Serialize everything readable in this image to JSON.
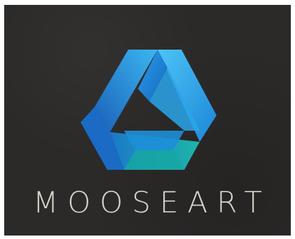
{
  "brand": {
    "name": "MOOSEART"
  },
  "logo": {
    "icon": "penrose-triangle-icon",
    "colors": {
      "light_blue": "#3bb7f0",
      "mid_blue": "#1d86d8",
      "deep_blue": "#1a5fb8",
      "teal": "#1fb5a8",
      "background": "#2c2a29",
      "text": "#d8d3cc"
    }
  }
}
